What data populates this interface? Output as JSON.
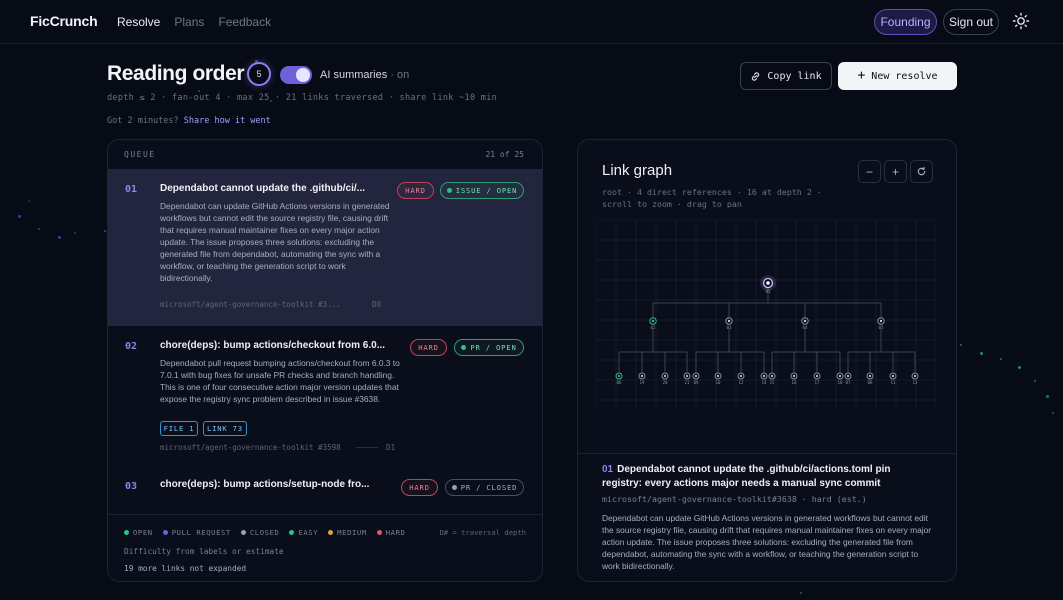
{
  "brand": "FicCrunch",
  "nav": [
    "Resolve",
    "Plans",
    "Feedback"
  ],
  "founding_label": "Founding",
  "signout_label": "Sign out",
  "header": {
    "title": "Reading order",
    "badge": "5",
    "ai_label": "AI summaries",
    "ai_state": "· on",
    "meta": "depth ≤ 2 · fan-out 4 · max 25 · 21 links traversed · share link ~10 min",
    "feedback_prefix": "Got 2 minutes?",
    "feedback_link": "Share how it went",
    "copy_label": "Copy link",
    "new_label": "New resolve"
  },
  "queue": {
    "heading": "QUEUE",
    "count": "21 of 25",
    "items": [
      {
        "num": "01",
        "title": "Dependabot cannot update the .github/ci/...",
        "difficulty": "HARD",
        "status": "ISSUE / OPEN",
        "desc": "Dependabot can update GitHub Actions versions in generated workflows but cannot edit the source registry file, causing drift that requires manual maintainer fixes on every major action update. The issue proposes three solutions: excluding the generated file from dependabot, automating the sync with a workflow, or teaching the generation script to work bidirectionally.",
        "repo": "microsoft/agent-governance-toolkit #3...",
        "depth": "D0"
      },
      {
        "num": "02",
        "title": "chore(deps): bump actions/checkout from 6.0...",
        "difficulty": "HARD",
        "status": "PR / OPEN",
        "desc": "Dependabot pull request bumping actions/checkout from 6.0.3 to 7.0.1 with bug fixes for unsafe PR checks and branch handling. This is one of four consecutive action major version updates that expose the registry sync problem described in issue #3638.",
        "tags": [
          "FILE 1",
          "LINK 73"
        ],
        "repo": "microsoft/agent-governance-toolkit #3598",
        "depth": "D1"
      },
      {
        "num": "03",
        "title": "chore(deps): bump actions/setup-node fro...",
        "difficulty": "HARD",
        "status": "PR / CLOSED"
      }
    ],
    "legend": [
      "OPEN",
      "PULL REQUEST",
      "CLOSED",
      "EASY",
      "MEDIUM",
      "HARD"
    ],
    "legend_depth": "D# = traversal depth",
    "legend_note": "Difficulty from labels or estimate",
    "legend_more": "19 more links not expanded"
  },
  "graph": {
    "title": "Link graph",
    "meta1": "root · 4 direct references · 16 at depth 2 ·",
    "meta2": "scroll to zoom · drag to pan",
    "root_label": "01",
    "level1_labels": [
      "02",
      "03",
      "04",
      "05"
    ],
    "level2_labels": [
      "06",
      "19",
      "20",
      "21",
      "09",
      "10",
      "12",
      "14",
      "15",
      "16",
      "17",
      "18",
      "07",
      "08",
      "11",
      "13"
    ],
    "detail": {
      "num": "01",
      "title": "Dependabot cannot update the .github/ci/actions.toml pin registry: every actions major needs a manual sync commit",
      "meta": "microsoft/agent-governance-toolkit#3638 · hard (est.)",
      "desc": "Dependabot can update GitHub Actions versions in generated workflows but cannot edit the source registry file, causing drift that requires manual maintainer fixes on every major action update. The issue proposes three solutions: excluding the generated file from dependabot, automating the sync with a workflow, or teaching the generation script to work bidirectionally."
    }
  },
  "colors": {
    "accent": "#8e84f0",
    "open": "#2fbf84",
    "pull_request": "#6f62d8",
    "closed": "#9aa0b2",
    "easy": "#2fbf84",
    "medium": "#e3a53a",
    "hard": "#e0566c"
  }
}
